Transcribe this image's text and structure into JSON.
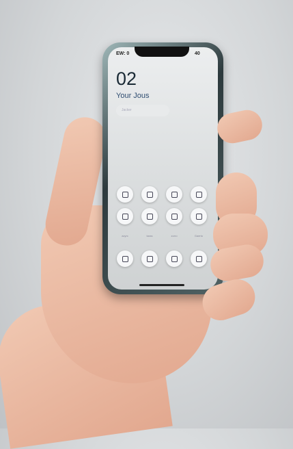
{
  "status": {
    "left": "EW: 0",
    "right": "40"
  },
  "clock": "02",
  "subtitle": "Your Jous",
  "search": {
    "placeholder": "Jacker"
  },
  "icon_rows": [
    [
      "app-icon",
      "app-icon",
      "app-icon",
      "app-icon"
    ],
    [
      "app-icon",
      "app-icon",
      "app-icon",
      "app-icon"
    ],
    [
      "app-icon",
      "app-icon",
      "app-icon",
      "app-icon"
    ]
  ],
  "labels": [
    "azyrc",
    "taras",
    "zorro",
    "Gaerto"
  ]
}
